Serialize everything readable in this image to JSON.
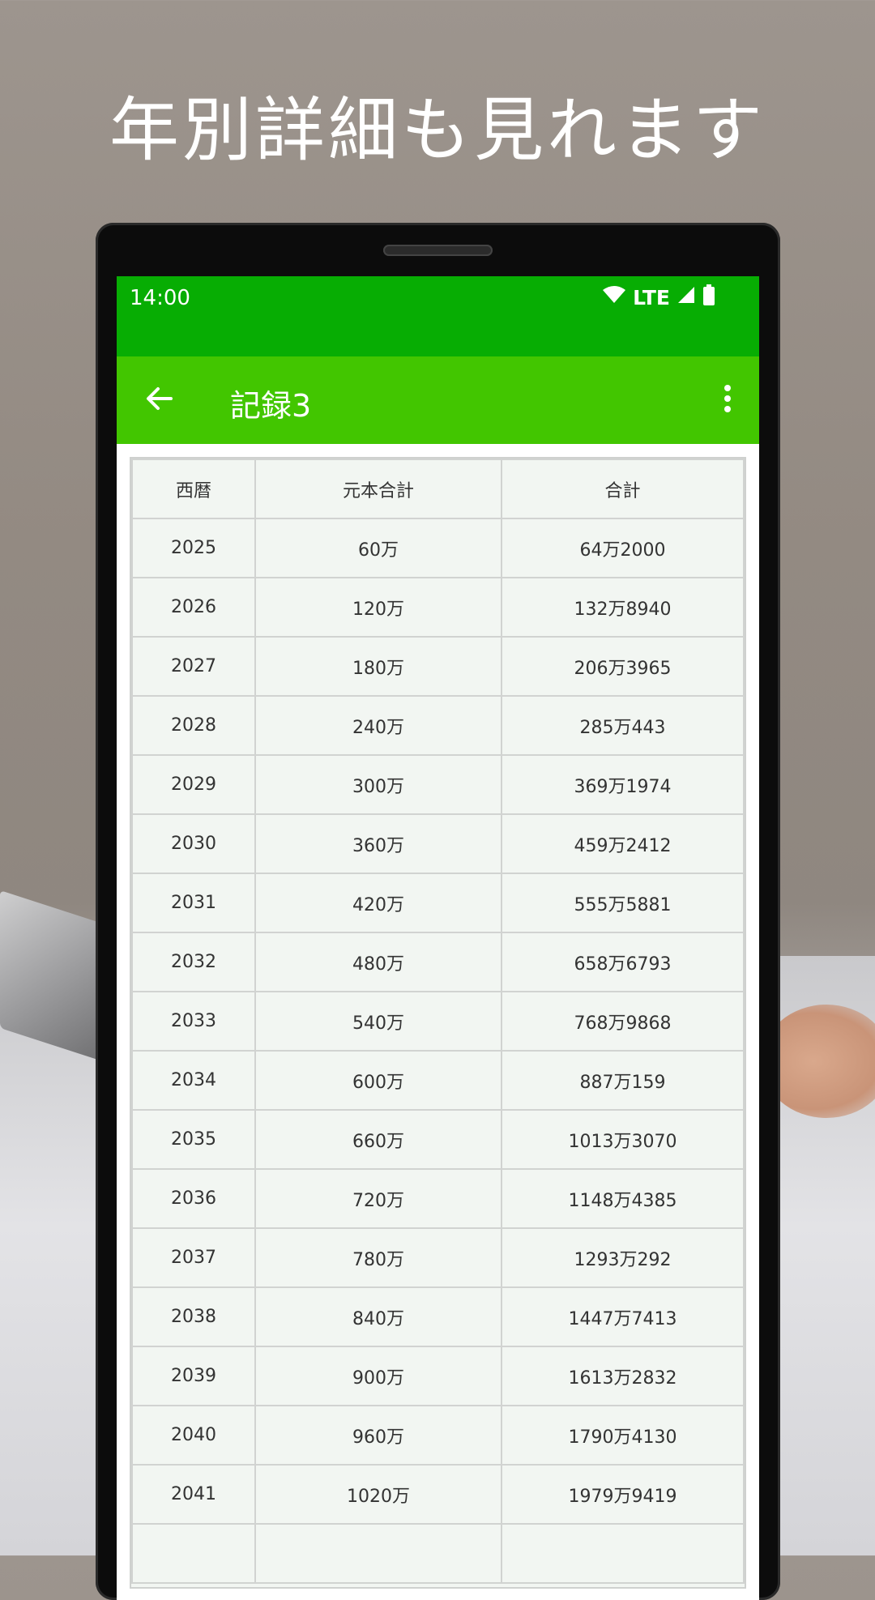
{
  "headline": "年別詳細も見れます",
  "status_bar": {
    "time": "14:00",
    "network": "LTE"
  },
  "app_bar": {
    "title": "記録3"
  },
  "table": {
    "headers": [
      "西暦",
      "元本合計",
      "合計"
    ],
    "rows": [
      [
        "2025",
        "60万",
        "64万2000"
      ],
      [
        "2026",
        "120万",
        "132万8940"
      ],
      [
        "2027",
        "180万",
        "206万3965"
      ],
      [
        "2028",
        "240万",
        "285万443"
      ],
      [
        "2029",
        "300万",
        "369万1974"
      ],
      [
        "2030",
        "360万",
        "459万2412"
      ],
      [
        "2031",
        "420万",
        "555万5881"
      ],
      [
        "2032",
        "480万",
        "658万6793"
      ],
      [
        "2033",
        "540万",
        "768万9868"
      ],
      [
        "2034",
        "600万",
        "887万159"
      ],
      [
        "2035",
        "660万",
        "1013万3070"
      ],
      [
        "2036",
        "720万",
        "1148万4385"
      ],
      [
        "2037",
        "780万",
        "1293万292"
      ],
      [
        "2038",
        "840万",
        "1447万7413"
      ],
      [
        "2039",
        "900万",
        "1613万2832"
      ],
      [
        "2040",
        "960万",
        "1790万4130"
      ],
      [
        "2041",
        "1020万",
        "1979万9419"
      ]
    ]
  },
  "colors": {
    "status_bar": "#07ad03",
    "app_bar": "#42c600",
    "table_bg": "#f2f6f2"
  },
  "icons": [
    "wifi-icon",
    "signal-icon",
    "battery-icon",
    "back-arrow-icon",
    "more-vert-icon"
  ]
}
